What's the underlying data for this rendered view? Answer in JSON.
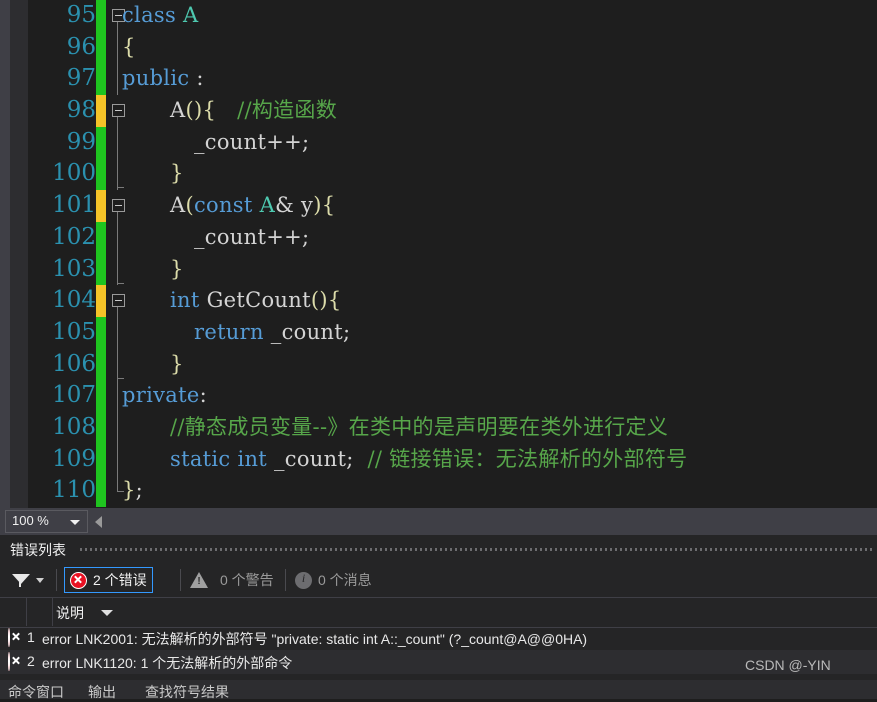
{
  "editor": {
    "zoom_level": "100 %",
    "lines": [
      {
        "num": "95",
        "change": "green",
        "fold": "box",
        "guide": "below",
        "indent": 0,
        "tokens": [
          {
            "t": "class ",
            "c": "kw"
          },
          {
            "t": "A",
            "c": "typ"
          }
        ]
      },
      {
        "num": "96",
        "change": "green",
        "fold": "none",
        "guide": "full",
        "indent": 0,
        "tokens": [
          {
            "t": "{",
            "c": "pun"
          }
        ]
      },
      {
        "num": "97",
        "change": "green",
        "fold": "none",
        "guide": "full",
        "indent": 0,
        "tokens": [
          {
            "t": "public",
            "c": "kw"
          },
          {
            "t": " :",
            "c": "pl"
          }
        ]
      },
      {
        "num": "98",
        "change": "yellow",
        "fold": "box",
        "guide": "below",
        "indent": 2,
        "tokens": [
          {
            "t": "A",
            "c": "pl"
          },
          {
            "t": "(",
            "c": "pun"
          },
          {
            "t": ")",
            "c": "pun"
          },
          {
            "t": "{",
            "c": "pun"
          },
          {
            "t": "   ",
            "c": "pl"
          },
          {
            "t": "//构造函数",
            "c": "cmt"
          }
        ]
      },
      {
        "num": "99",
        "change": "green",
        "fold": "none",
        "guide": "full",
        "indent": 3,
        "tokens": [
          {
            "t": "_count++;",
            "c": "pl"
          }
        ]
      },
      {
        "num": "100",
        "change": "green",
        "fold": "none",
        "guide": "endtop",
        "indent": 2,
        "tokens": [
          {
            "t": "}",
            "c": "pun"
          }
        ]
      },
      {
        "num": "101",
        "change": "yellow",
        "fold": "box",
        "guide": "below",
        "indent": 2,
        "tokens": [
          {
            "t": "A",
            "c": "pl"
          },
          {
            "t": "(",
            "c": "pun"
          },
          {
            "t": "const",
            "c": "kw"
          },
          {
            "t": " A",
            "c": "typ"
          },
          {
            "t": "& y",
            "c": "pl"
          },
          {
            "t": ")",
            "c": "pun"
          },
          {
            "t": "{",
            "c": "pun"
          }
        ]
      },
      {
        "num": "102",
        "change": "green",
        "fold": "none",
        "guide": "full",
        "indent": 3,
        "tokens": [
          {
            "t": "_count++;",
            "c": "pl"
          }
        ]
      },
      {
        "num": "103",
        "change": "green",
        "fold": "none",
        "guide": "endtop",
        "indent": 2,
        "tokens": [
          {
            "t": "}",
            "c": "pun"
          }
        ]
      },
      {
        "num": "104",
        "change": "yellow",
        "fold": "box",
        "guide": "below",
        "indent": 2,
        "tokens": [
          {
            "t": "int",
            "c": "kw"
          },
          {
            "t": " GetCount",
            "c": "pl"
          },
          {
            "t": "(",
            "c": "pun"
          },
          {
            "t": ")",
            "c": "pun"
          },
          {
            "t": "{",
            "c": "pun"
          }
        ]
      },
      {
        "num": "105",
        "change": "green",
        "fold": "none",
        "guide": "full",
        "indent": 3,
        "tokens": [
          {
            "t": "return",
            "c": "kw"
          },
          {
            "t": " _count;",
            "c": "pl"
          }
        ]
      },
      {
        "num": "106",
        "change": "green",
        "fold": "none",
        "guide": "endtop",
        "indent": 2,
        "tokens": [
          {
            "t": "}",
            "c": "pun"
          }
        ]
      },
      {
        "num": "107",
        "change": "green",
        "fold": "none",
        "guide": "full",
        "indent": 0,
        "tokens": [
          {
            "t": "private",
            "c": "kw"
          },
          {
            "t": ":",
            "c": "pl"
          }
        ]
      },
      {
        "num": "108",
        "change": "green",
        "fold": "none",
        "guide": "full",
        "indent": 2,
        "tokens": [
          {
            "t": "//静态成员变量--》在类中的是声明要在类外进行定义",
            "c": "cmt"
          }
        ]
      },
      {
        "num": "109",
        "change": "green",
        "fold": "none",
        "guide": "full",
        "indent": 2,
        "tokens": [
          {
            "t": "static",
            "c": "kw"
          },
          {
            "t": " ",
            "c": "pl"
          },
          {
            "t": "int",
            "c": "kw"
          },
          {
            "t": " _count;",
            "c": "pl"
          },
          {
            "t": "  ",
            "c": "pl"
          },
          {
            "t": "// 链接错误：无法解析的外部符号",
            "c": "cmt"
          }
        ]
      },
      {
        "num": "110",
        "change": "green",
        "fold": "none",
        "guide": "endbot",
        "indent": 0,
        "tokens": [
          {
            "t": "}",
            "c": "pun"
          },
          {
            "t": ";",
            "c": "pl"
          }
        ]
      }
    ]
  },
  "error_panel": {
    "title": "错误列表",
    "filters": [
      {
        "icon": "error-icon",
        "label": "2 个错误",
        "selected": true
      },
      {
        "icon": "warning-icon",
        "label": "0 个警告",
        "selected": false
      },
      {
        "icon": "info-icon",
        "label": "0 个消息",
        "selected": false
      }
    ],
    "columns": [
      "说明"
    ],
    "rows": [
      {
        "icon": "error-icon",
        "num": "1",
        "text": "error LNK2001: 无法解析的外部符号 \"private: static int A::_count\" (?_count@A@@0HA)"
      },
      {
        "icon": "error-icon",
        "num": "2",
        "text": "error LNK1120: 1 个无法解析的外部命令"
      }
    ]
  },
  "bottom_tabs": [
    {
      "label": "命令窗口"
    },
    {
      "label": "输出"
    },
    {
      "label": "查找符号结果"
    }
  ],
  "watermark": "CSDN @-YIN",
  "colors": {
    "editor_bg": "#1e1e1e",
    "keyword": "#569cd6",
    "type": "#4ec9b0",
    "comment": "#57a64a",
    "linenum": "#2b91af",
    "change_saved": "#1fc41f",
    "change_unsaved": "#f5c328",
    "error_red": "#e81123",
    "accent_blue": "#3399ff"
  }
}
